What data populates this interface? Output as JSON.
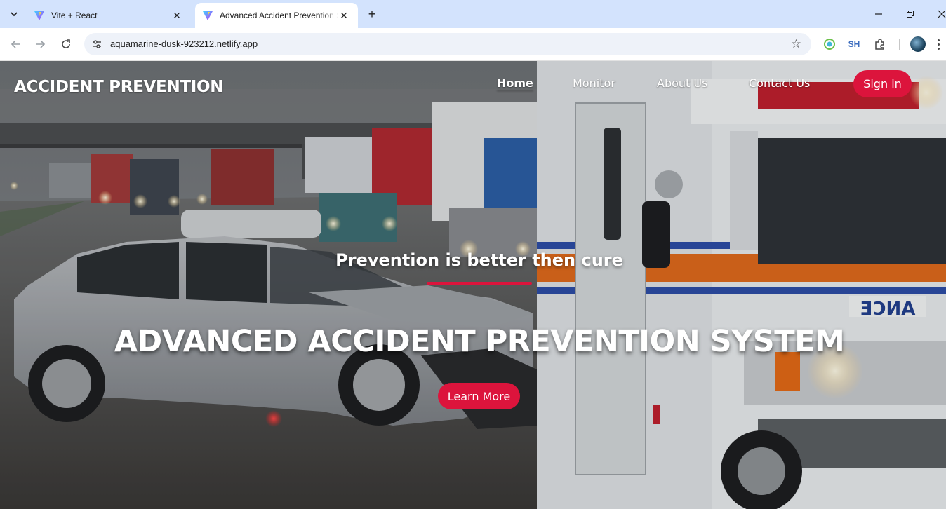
{
  "browser": {
    "tabs": [
      {
        "title": "Vite + React",
        "active": false
      },
      {
        "title": "Advanced Accident Prevention System",
        "active": true
      }
    ],
    "url": "aquamarine-dusk-923212.netlify.app",
    "extension_label": "SH",
    "icons": {
      "tab_menu": "chevron-down-icon",
      "favicon": "vite-logo-icon",
      "close": "close-icon",
      "new_tab": "plus-icon",
      "back": "arrow-left-icon",
      "forward": "arrow-right-icon",
      "reload": "reload-icon",
      "site_info": "tune-icon",
      "bookmark": "star-icon",
      "extensions": "puzzle-icon",
      "menu": "kebab-menu-icon"
    }
  },
  "site": {
    "brand": "ACCIDENT PREVENTION",
    "nav": [
      {
        "label": "Home",
        "active": true
      },
      {
        "label": "Monitor",
        "active": false
      },
      {
        "label": "About Us",
        "active": false
      },
      {
        "label": "Contact Us",
        "active": false
      }
    ],
    "signin_label": "Sign in",
    "hero": {
      "tagline": "Prevention is better then cure",
      "headline": "ADVANCED ACCIDENT PREVENTION SYSTEM",
      "cta_label": "Learn More"
    },
    "colors": {
      "accent": "#dc143c",
      "text": "#ffffff"
    }
  }
}
